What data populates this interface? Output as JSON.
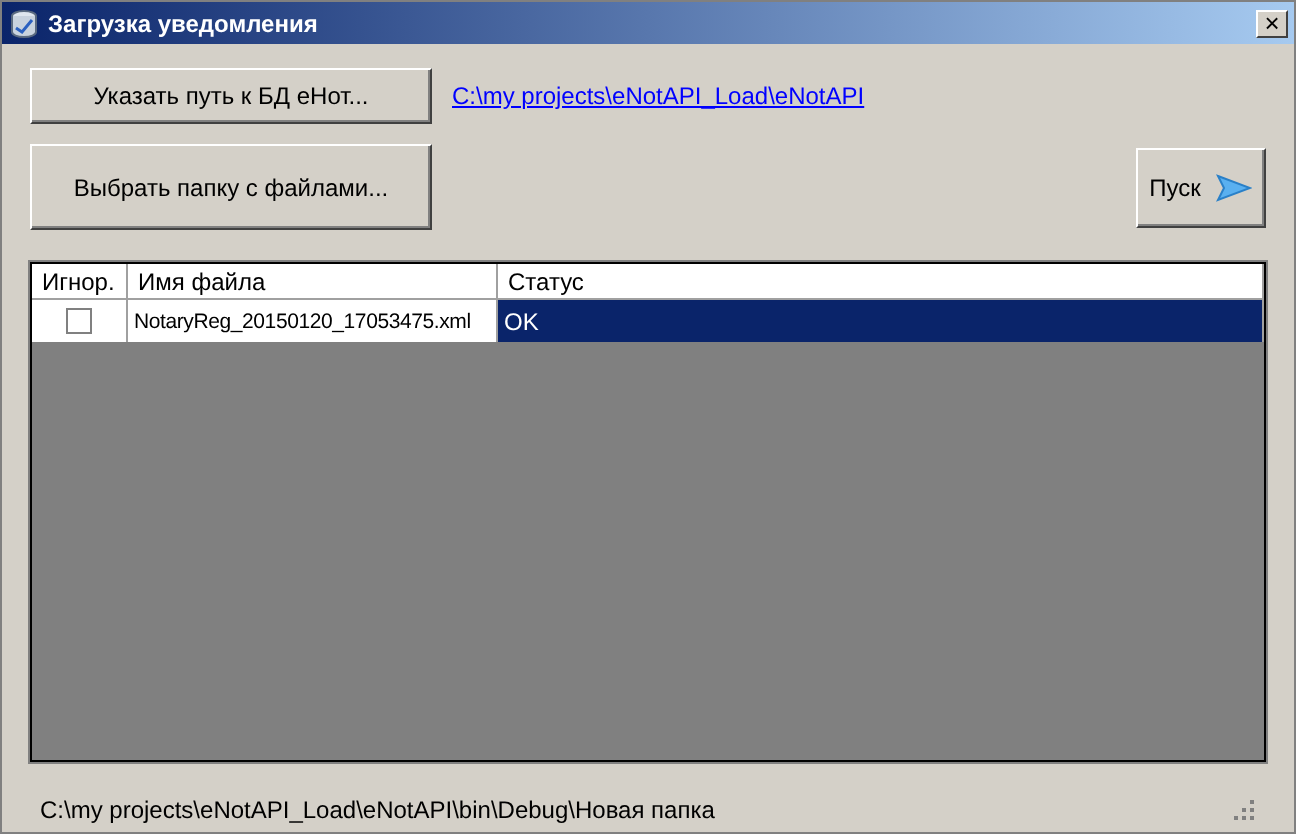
{
  "window": {
    "title": "Загрузка уведомления",
    "close": "×"
  },
  "buttons": {
    "db_path": "Указать путь к БД eHот...",
    "folder": "Выбрать папку с файлами...",
    "start": "Пуск"
  },
  "db_link": "C:\\my projects\\eNotAPI_Load\\eNotAPI",
  "table": {
    "columns": [
      "Игнор.",
      "Имя файла",
      "Статус"
    ],
    "rows": [
      {
        "checked": false,
        "file": "NotaryReg_20150120_17053475.xml",
        "status": "OK",
        "selected": true
      }
    ]
  },
  "status_bar": "C:\\my projects\\eNotAPI_Load\\eNotAPI\\bin\\Debug\\Новая папка"
}
